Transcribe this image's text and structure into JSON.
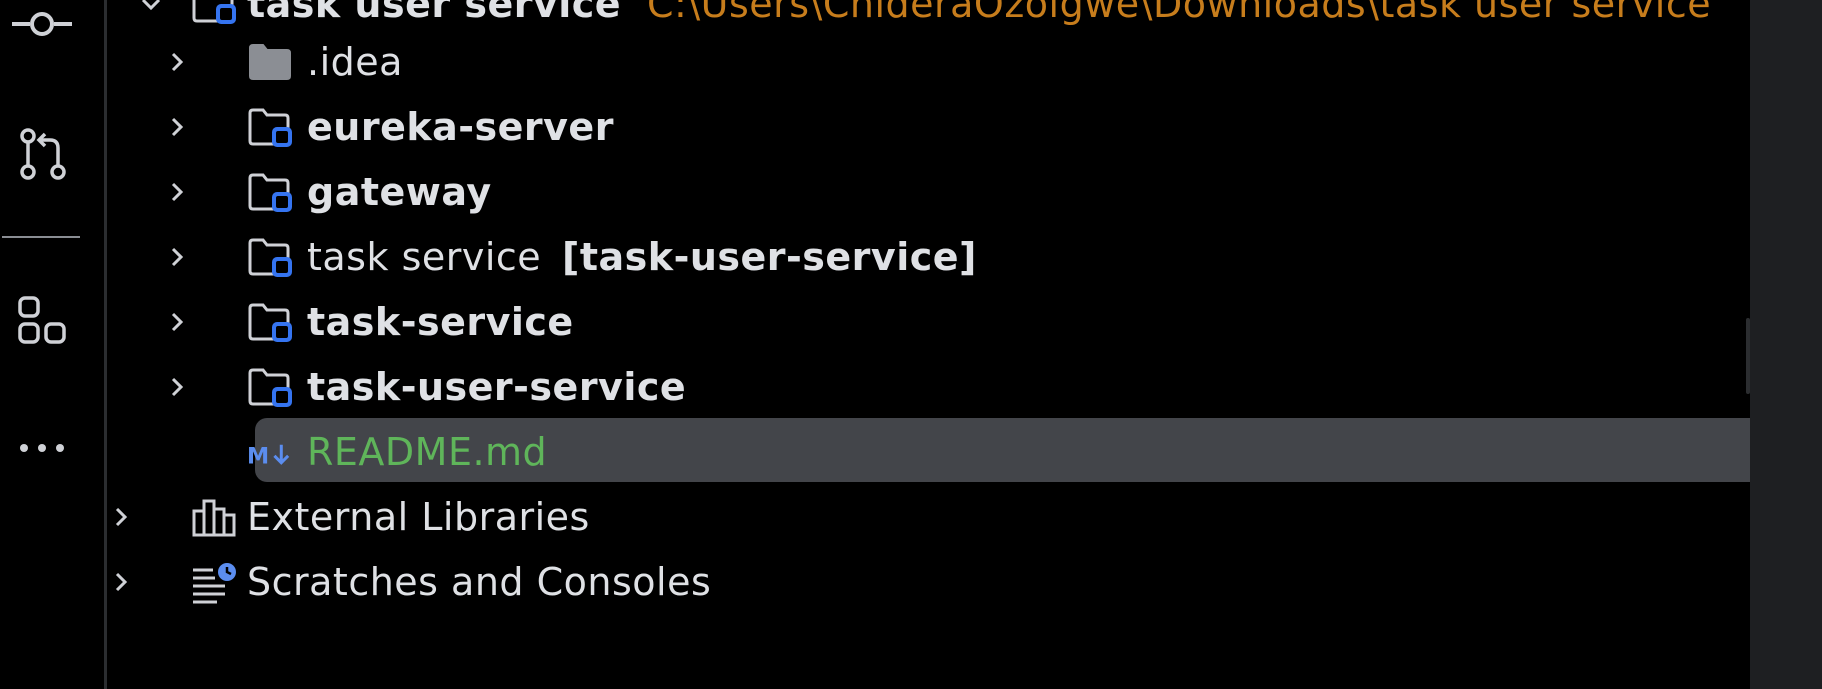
{
  "colors": {
    "background": "#000000",
    "text": "#dfe1e5",
    "selection": "#43454a",
    "module_badge": "#3574f0",
    "path_text": "#c77d1c",
    "markdown_text": "#5fb55a"
  },
  "toolstrip": {
    "items": [
      {
        "icon": "commit-icon"
      },
      {
        "icon": "pull-requests-icon"
      },
      {
        "icon": "structure-icon"
      },
      {
        "icon": "more-icon"
      }
    ]
  },
  "tree": {
    "root": {
      "label": "task user service",
      "path": "C:\\Users\\ChideraOzoigwe\\Downloads\\task user service",
      "icon": "module-folder-icon"
    },
    "items": [
      {
        "label": ".idea",
        "icon": "folder-icon",
        "bold": false
      },
      {
        "label": "eureka-server",
        "icon": "module-folder-icon",
        "bold": true
      },
      {
        "label": "gateway",
        "icon": "module-folder-icon",
        "bold": true
      },
      {
        "label": "task service",
        "suffix": "[task-user-service]",
        "icon": "module-folder-icon",
        "bold": false
      },
      {
        "label": "task-service",
        "icon": "module-folder-icon",
        "bold": true
      },
      {
        "label": "task-user-service",
        "icon": "module-folder-icon",
        "bold": true
      },
      {
        "label": "README.md",
        "icon": "markdown-icon",
        "selected": true
      }
    ],
    "bottom": [
      {
        "label": "External Libraries",
        "icon": "libraries-icon"
      },
      {
        "label": "Scratches and Consoles",
        "icon": "scratches-icon"
      }
    ]
  }
}
